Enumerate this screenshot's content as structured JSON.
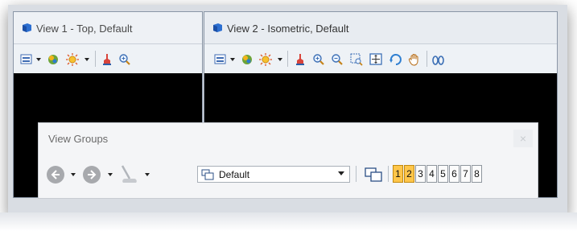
{
  "view1": {
    "title": "View 1 - Top, Default",
    "icons": [
      "view-attributes-icon",
      "display-style-icon",
      "lights-icon",
      "clear-icon",
      "zoom-icon"
    ]
  },
  "view2": {
    "title": "View 2 - Isometric, Default",
    "icons": [
      "view-attributes-icon",
      "display-style-icon",
      "lights-icon",
      "clear-icon",
      "zoom-in-icon",
      "zoom-out-icon",
      "window-area-icon",
      "fit-view-icon",
      "rotate-view-icon",
      "pan-icon",
      "view-previous-icon"
    ]
  },
  "view_groups": {
    "title": "View Groups",
    "close_label": "×",
    "selected_group": "Default",
    "view_numbers": [
      "1",
      "2",
      "3",
      "4",
      "5",
      "6",
      "7",
      "8"
    ],
    "active_views": [
      "1",
      "2"
    ]
  },
  "colors": {
    "active_view_button": "#ffc64a",
    "viewport": "#000000",
    "title_bar": "#e8ecf1"
  }
}
